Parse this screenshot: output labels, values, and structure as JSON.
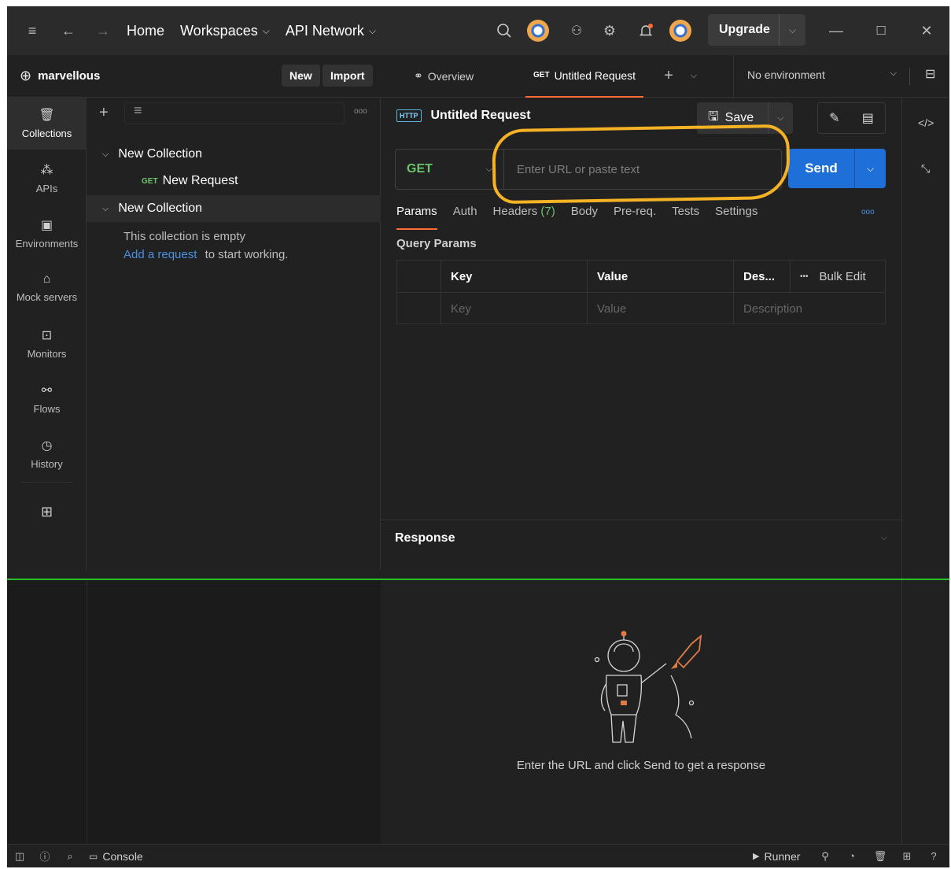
{
  "titlebar": {
    "nav": {
      "home": "Home",
      "workspaces": "Workspaces",
      "api_network": "API Network"
    },
    "upgrade_label": "Upgrade"
  },
  "workspace": {
    "name": "marvellous",
    "new_label": "New",
    "import_label": "Import"
  },
  "leftnav": [
    {
      "label": "Collections",
      "icon": "trash-can-icon"
    },
    {
      "label": "APIs",
      "icon": "apis-icon"
    },
    {
      "label": "Environments",
      "icon": "environment-icon"
    },
    {
      "label": "Mock servers",
      "icon": "server-icon"
    },
    {
      "label": "Monitors",
      "icon": "monitor-icon"
    },
    {
      "label": "Flows",
      "icon": "flows-icon"
    },
    {
      "label": "History",
      "icon": "history-icon"
    }
  ],
  "tree": {
    "collection1": "New Collection",
    "request1": {
      "method": "GET",
      "name": "New Request"
    },
    "collection2": "New Collection",
    "empty_text": "This collection is empty",
    "add_link": "Add a request",
    "add_suffix": "to start working."
  },
  "tabs": {
    "overview": "Overview",
    "active": {
      "method": "GET",
      "name": "Untitled Request"
    },
    "environment": "No environment"
  },
  "request": {
    "badge": "HTTP",
    "title": "Untitled Request",
    "save_label": "Save",
    "method": "GET",
    "url_placeholder": "Enter URL or paste text",
    "send_label": "Send",
    "subtabs": {
      "params": "Params",
      "auth": "Auth",
      "headers": "Headers",
      "headers_count": "(7)",
      "body": "Body",
      "prereq": "Pre-req.",
      "tests": "Tests",
      "settings": "Settings"
    },
    "query_params_label": "Query Params",
    "params_table": {
      "headers": {
        "key": "Key",
        "value": "Value",
        "description": "Des...",
        "more": "•••",
        "bulk_edit": "Bulk Edit"
      },
      "placeholders": {
        "key": "Key",
        "value": "Value",
        "description": "Description"
      }
    }
  },
  "response": {
    "title": "Response",
    "empty_message": "Enter the URL and click Send to get a response"
  },
  "statusbar": {
    "console": "Console",
    "runner": "Runner"
  },
  "colors": {
    "accent": "#ff6c37",
    "send": "#1f6fd8",
    "get_method": "#6bc46d",
    "annotation": "#f5b225"
  }
}
